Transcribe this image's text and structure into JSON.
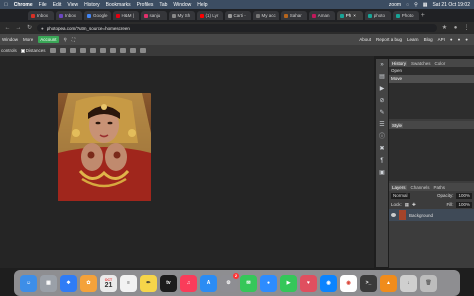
{
  "macbar": {
    "apple": "",
    "items": [
      "Chrome",
      "File",
      "Edit",
      "View",
      "History",
      "Bookmarks",
      "Profiles",
      "Tab",
      "Window",
      "Help"
    ],
    "zoom": "zoom",
    "datetime": "Sat 21 Oct 19:02"
  },
  "tabs": [
    {
      "label": "Inbox"
    },
    {
      "label": "Inbox"
    },
    {
      "label": "Google"
    },
    {
      "label": "H&M |"
    },
    {
      "label": "sanju"
    },
    {
      "label": "My Sh"
    },
    {
      "label": "(1) Lyr"
    },
    {
      "label": "Carti -"
    },
    {
      "label": "My acc"
    },
    {
      "label": "Sahar"
    },
    {
      "label": "Aman"
    },
    {
      "label": "Ph"
    },
    {
      "label": "photo"
    },
    {
      "label": "Photo"
    }
  ],
  "address": {
    "url": "photopea.com/?utm_source=homescreen"
  },
  "menubar": {
    "items": [
      "Window",
      "More"
    ],
    "account": "Account",
    "right": [
      "About",
      "Report a bug",
      "Learn",
      "Blog",
      "API"
    ]
  },
  "optbar": {
    "left_label": "controls",
    "distances": "Distances"
  },
  "panels": {
    "history_tabs": [
      "History",
      "Swatches",
      "Color"
    ],
    "history_items": [
      "Open",
      "Move"
    ],
    "style_tab": "Style",
    "layer_tabs": [
      "Layers",
      "Channels",
      "Paths"
    ],
    "blend_mode": "Normal",
    "opacity_label": "Opacity:",
    "opacity_value": "100%",
    "lock_label": "Lock:",
    "fill_label": "Fill:",
    "fill_value": "100%",
    "layer_name": "Background"
  },
  "dock": {
    "calendar_month": "OCT",
    "calendar_day": "21",
    "badge": "2"
  },
  "colors": {
    "account_green": "#3aa757",
    "mac_bar": "#3c4d62",
    "dark_panel": "#2d2d2d"
  }
}
